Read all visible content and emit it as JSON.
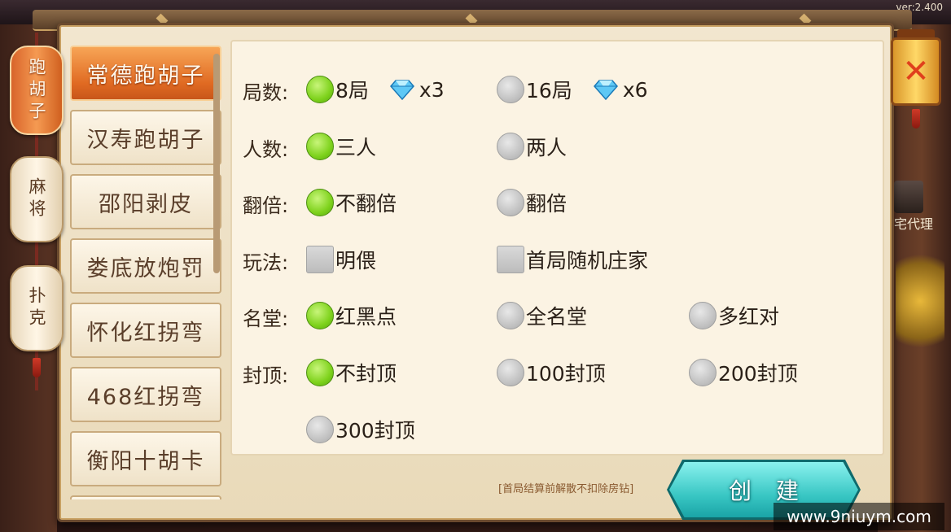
{
  "version": "ver:2.400",
  "categories": [
    {
      "label": "跑胡子",
      "active": true
    },
    {
      "label": "麻将",
      "active": false
    },
    {
      "label": "扑克",
      "active": false
    }
  ],
  "games": [
    {
      "label": "常德跑胡子",
      "active": true
    },
    {
      "label": "汉寿跑胡子",
      "active": false
    },
    {
      "label": "邵阳剥皮",
      "active": false
    },
    {
      "label": "娄底放炮罚",
      "active": false
    },
    {
      "label": "怀化红拐弯",
      "active": false
    },
    {
      "label": "468红拐弯",
      "active": false
    },
    {
      "label": "衡阳十胡卡",
      "active": false
    }
  ],
  "options": {
    "rounds": {
      "label": "局数:",
      "choices": [
        {
          "text": "8局",
          "cost": "x3",
          "selected": true
        },
        {
          "text": "16局",
          "cost": "x6",
          "selected": false
        }
      ]
    },
    "players": {
      "label": "人数:",
      "choices": [
        {
          "text": "三人",
          "selected": true
        },
        {
          "text": "两人",
          "selected": false
        }
      ]
    },
    "double": {
      "label": "翻倍:",
      "choices": [
        {
          "text": "不翻倍",
          "selected": true
        },
        {
          "text": "翻倍",
          "selected": false
        }
      ]
    },
    "play": {
      "label": "玩法:",
      "choices": [
        {
          "text": "明偎",
          "checked": false
        },
        {
          "text": "首局随机庄家",
          "checked": false
        }
      ]
    },
    "hall": {
      "label": "名堂:",
      "choices": [
        {
          "text": "红黑点",
          "selected": true
        },
        {
          "text": "全名堂",
          "selected": false
        },
        {
          "text": "多红对",
          "selected": false
        }
      ]
    },
    "cap": {
      "label": "封顶:",
      "choices": [
        {
          "text": "不封顶",
          "selected": true
        },
        {
          "text": "100封顶",
          "selected": false
        },
        {
          "text": "200封顶",
          "selected": false
        },
        {
          "text": "300封顶",
          "selected": false
        }
      ]
    }
  },
  "note": "[首局结算前解散不扣除房钻]",
  "create_label": "创建",
  "side_label": "宅代理",
  "watermark": "www.9niuym.com",
  "colors": {
    "selected_radio": "#7ed21c",
    "active_tab": "#e06a22",
    "create_button": "#39c7c4"
  },
  "icons": {
    "cost": "diamond-icon",
    "close": "close-icon"
  }
}
